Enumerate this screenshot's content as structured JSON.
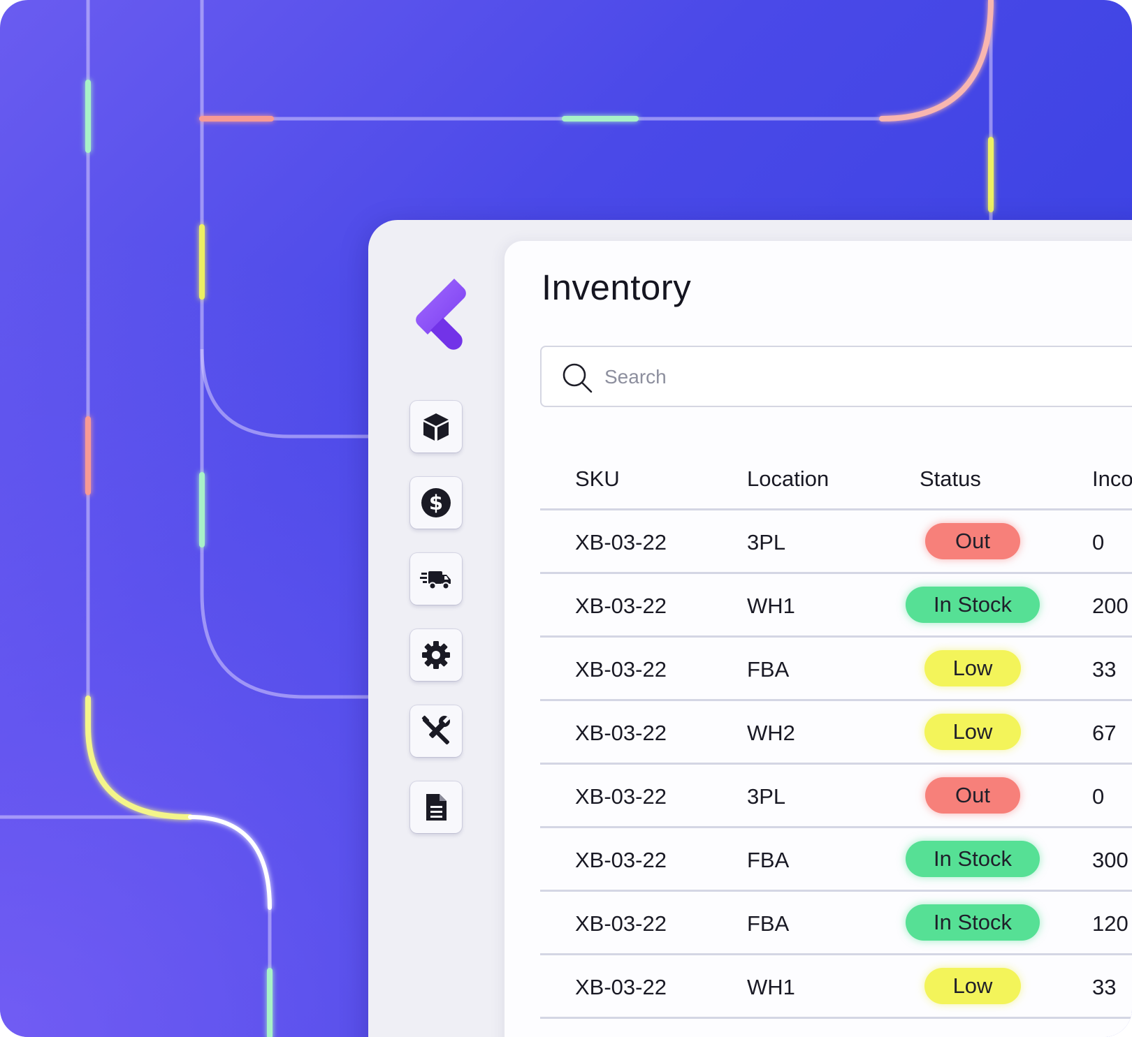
{
  "page": {
    "title": "Inventory"
  },
  "search": {
    "placeholder": "Search",
    "icon": "search-icon"
  },
  "nav": {
    "logo": "brand-logo",
    "items": [
      {
        "icon": "box-icon"
      },
      {
        "icon": "dollar-icon"
      },
      {
        "icon": "truck-icon"
      },
      {
        "icon": "gear-icon"
      },
      {
        "icon": "tools-icon"
      },
      {
        "icon": "document-icon"
      }
    ]
  },
  "table": {
    "columns": {
      "sku": "SKU",
      "location": "Location",
      "status": "Status",
      "incoming": "Inco"
    },
    "rows": [
      {
        "sku": "XB-03-22",
        "location": "3PL",
        "status": "Out",
        "incoming": "0"
      },
      {
        "sku": "XB-03-22",
        "location": "WH1",
        "status": "In Stock",
        "incoming": "200"
      },
      {
        "sku": "XB-03-22",
        "location": "FBA",
        "status": "Low",
        "incoming": "33"
      },
      {
        "sku": "XB-03-22",
        "location": "WH2",
        "status": "Low",
        "incoming": "67"
      },
      {
        "sku": "XB-03-22",
        "location": "3PL",
        "status": "Out",
        "incoming": "0"
      },
      {
        "sku": "XB-03-22",
        "location": "FBA",
        "status": "In Stock",
        "incoming": "300"
      },
      {
        "sku": "XB-03-22",
        "location": "FBA",
        "status": "In Stock",
        "incoming": "120"
      },
      {
        "sku": "XB-03-22",
        "location": "WH1",
        "status": "Low",
        "incoming": "33"
      }
    ]
  },
  "colors": {
    "status_out": "#f7807a",
    "status_in_stock": "#56e095",
    "status_low": "#f3f45a",
    "accent": "#7b4bf0"
  }
}
